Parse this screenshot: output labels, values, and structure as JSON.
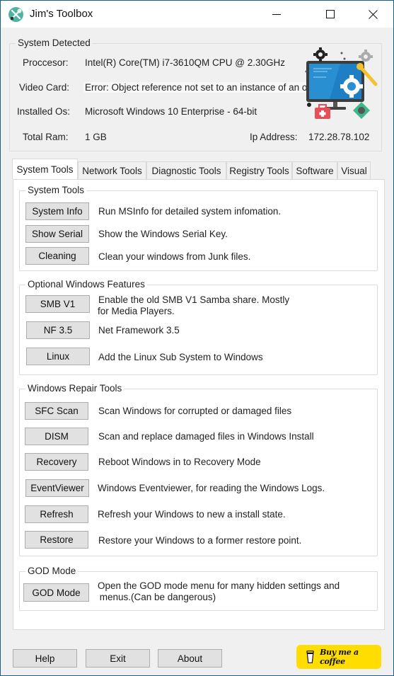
{
  "window": {
    "title": "Jim's Toolbox",
    "controls": {
      "minimize": "minimize",
      "maximize": "maximize",
      "close": "close"
    }
  },
  "system_detected": {
    "legend": "System Detected",
    "processor_label": "Proccesor:",
    "processor_value": "Intel(R) Core(TM) i7-3610QM CPU @ 2.30GHz",
    "video_label": "Video Card:",
    "video_value": "Error: Object reference not set to an instance of an object.",
    "os_label": "Installed Os:",
    "os_value": "Microsoft Windows 10 Enterprise - 64-bit",
    "ram_label": "Total Ram:",
    "ram_value": "1 GB",
    "ip_label": "Ip Address:",
    "ip_value": "172.28.78.102"
  },
  "tabs": [
    {
      "label": "System Tools",
      "active": true
    },
    {
      "label": "Network Tools",
      "active": false
    },
    {
      "label": "Diagnostic Tools",
      "active": false
    },
    {
      "label": "Registry Tools",
      "active": false
    },
    {
      "label": "Software",
      "active": false
    },
    {
      "label": "Visual",
      "active": false
    }
  ],
  "groups": {
    "system_tools": {
      "legend": "System Tools",
      "items": [
        {
          "button": "System Info",
          "desc": "Run MSInfo for detailed system infomation."
        },
        {
          "button": "Show Serial",
          "desc": "Show the Windows Serial Key."
        },
        {
          "button": "Cleaning",
          "desc": "Clean your windows from Junk files."
        }
      ]
    },
    "optional_features": {
      "legend": "Optional Windows Features",
      "items": [
        {
          "button": "SMB V1",
          "desc": "Enable the old SMB V1 Samba share. Mostly",
          "desc2": "for Media Players."
        },
        {
          "button": "NF 3.5",
          "desc": "Net Framework 3.5"
        },
        {
          "button": "Linux",
          "desc": "Add the Linux Sub System to Windows"
        }
      ]
    },
    "repair_tools": {
      "legend": "Windows Repair Tools",
      "items": [
        {
          "button": "SFC Scan",
          "desc": "Scan Windows for corrupted or damaged files"
        },
        {
          "button": "DISM",
          "desc": "Scan and replace damaged files in Windows Install"
        },
        {
          "button": "Recovery",
          "desc": "Reboot Windows in to Recovery Mode"
        },
        {
          "button": "EventViewer",
          "desc": "Windows Eventviewer, for reading the Windows Logs."
        },
        {
          "button": "Refresh",
          "desc": "Refresh your Windows to new a install state."
        },
        {
          "button": "Restore",
          "desc": "Restore your Windows to a former restore point."
        }
      ]
    },
    "god_mode": {
      "legend": "GOD Mode",
      "items": [
        {
          "button": "GOD Mode",
          "desc": "Open the GOD mode menu for many hidden settings and",
          "desc2": " menus.(Can be dangerous)"
        }
      ]
    }
  },
  "footer": {
    "help": "Help",
    "exit": "Exit",
    "about": "About",
    "coffee": "Buy me a coffee"
  },
  "colors": {
    "window_border": "#1a5e87",
    "coffee_bg": "#ffdd00",
    "app_icon": "#4fb3a2"
  }
}
